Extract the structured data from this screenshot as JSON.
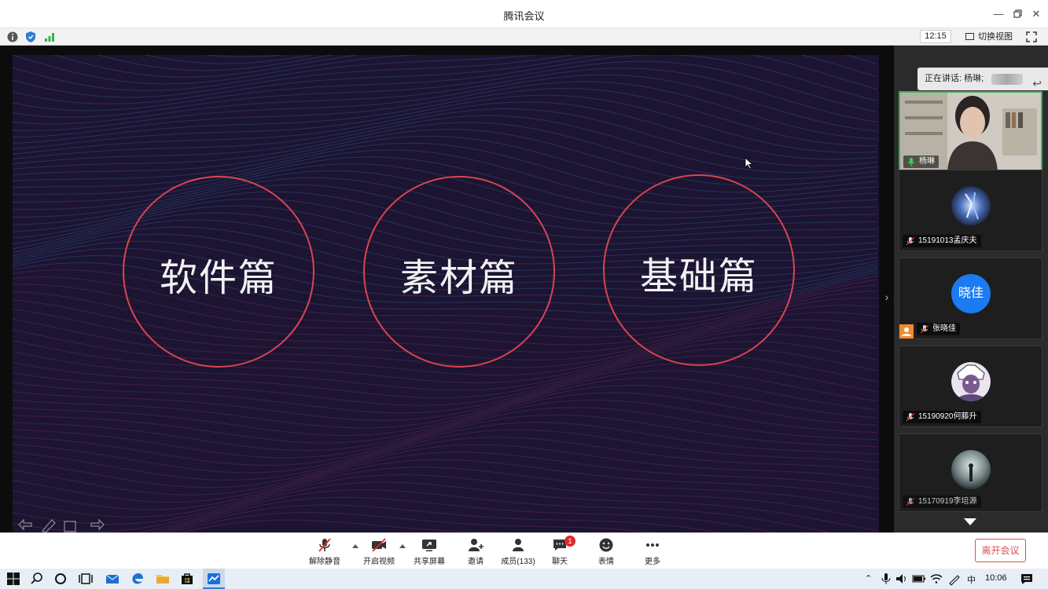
{
  "window": {
    "title": "腾讯会议"
  },
  "infobar": {
    "time": "12:15",
    "switch_view_label": "切换视图"
  },
  "slide": {
    "circles": [
      "软件篇",
      "素材篇",
      "基础篇"
    ],
    "accent": "#d8454f",
    "background": "#1d1432"
  },
  "panel": {
    "speaking_label": "正在讲话: 杨琳;",
    "tiles": [
      {
        "name": "杨琳",
        "kind": "video"
      },
      {
        "name": "15191013孟庆夫",
        "kind": "avatar-image"
      },
      {
        "name": "张晓佳",
        "kind": "avatar-text",
        "avatar_text": "晓佳"
      },
      {
        "name": "15190920何藤升",
        "kind": "avatar-image"
      },
      {
        "name": "15170919李培源",
        "kind": "avatar-image"
      }
    ]
  },
  "toolbar": {
    "unmute": "解除静音",
    "start_video": "开启视频",
    "share_screen": "共享屏幕",
    "invite": "邀请",
    "members": "成员(133)",
    "chat": "聊天",
    "chat_badge": "1",
    "reactions": "表情",
    "more": "更多",
    "leave": "离开会议"
  },
  "taskbar": {
    "ime": "中",
    "time": "10:06"
  }
}
